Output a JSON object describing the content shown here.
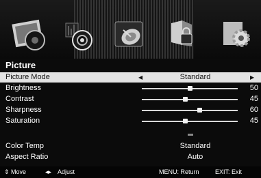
{
  "menu": {
    "title": "Picture",
    "tabs": [
      {
        "name": "picture-tab",
        "icon": "picture-icon",
        "selected": true
      },
      {
        "name": "sound-tab",
        "icon": "speaker-icon",
        "selected": false
      },
      {
        "name": "channel-tab",
        "icon": "satellite-dish-icon",
        "selected": false
      },
      {
        "name": "lock-tab",
        "icon": "lock-icon",
        "selected": false
      },
      {
        "name": "setup-tab",
        "icon": "gear-icon",
        "selected": false
      }
    ],
    "items": [
      {
        "label": "Picture Mode",
        "value": "Standard"
      },
      {
        "label": "Brightness",
        "value": "50",
        "level": 50
      },
      {
        "label": "Contrast",
        "value": "45",
        "level": 45
      },
      {
        "label": "Sharpness",
        "value": "60",
        "level": 60
      },
      {
        "label": "Saturation",
        "value": "45",
        "level": 45
      },
      {
        "label": "Color Temp",
        "value": "Standard"
      },
      {
        "label": "Aspect Ratio",
        "value": "Auto"
      }
    ]
  },
  "footer": {
    "move": "Move",
    "adjust": "Adjust",
    "menu_return": "MENU: Return",
    "exit_exit": "EXIT: Exit"
  }
}
